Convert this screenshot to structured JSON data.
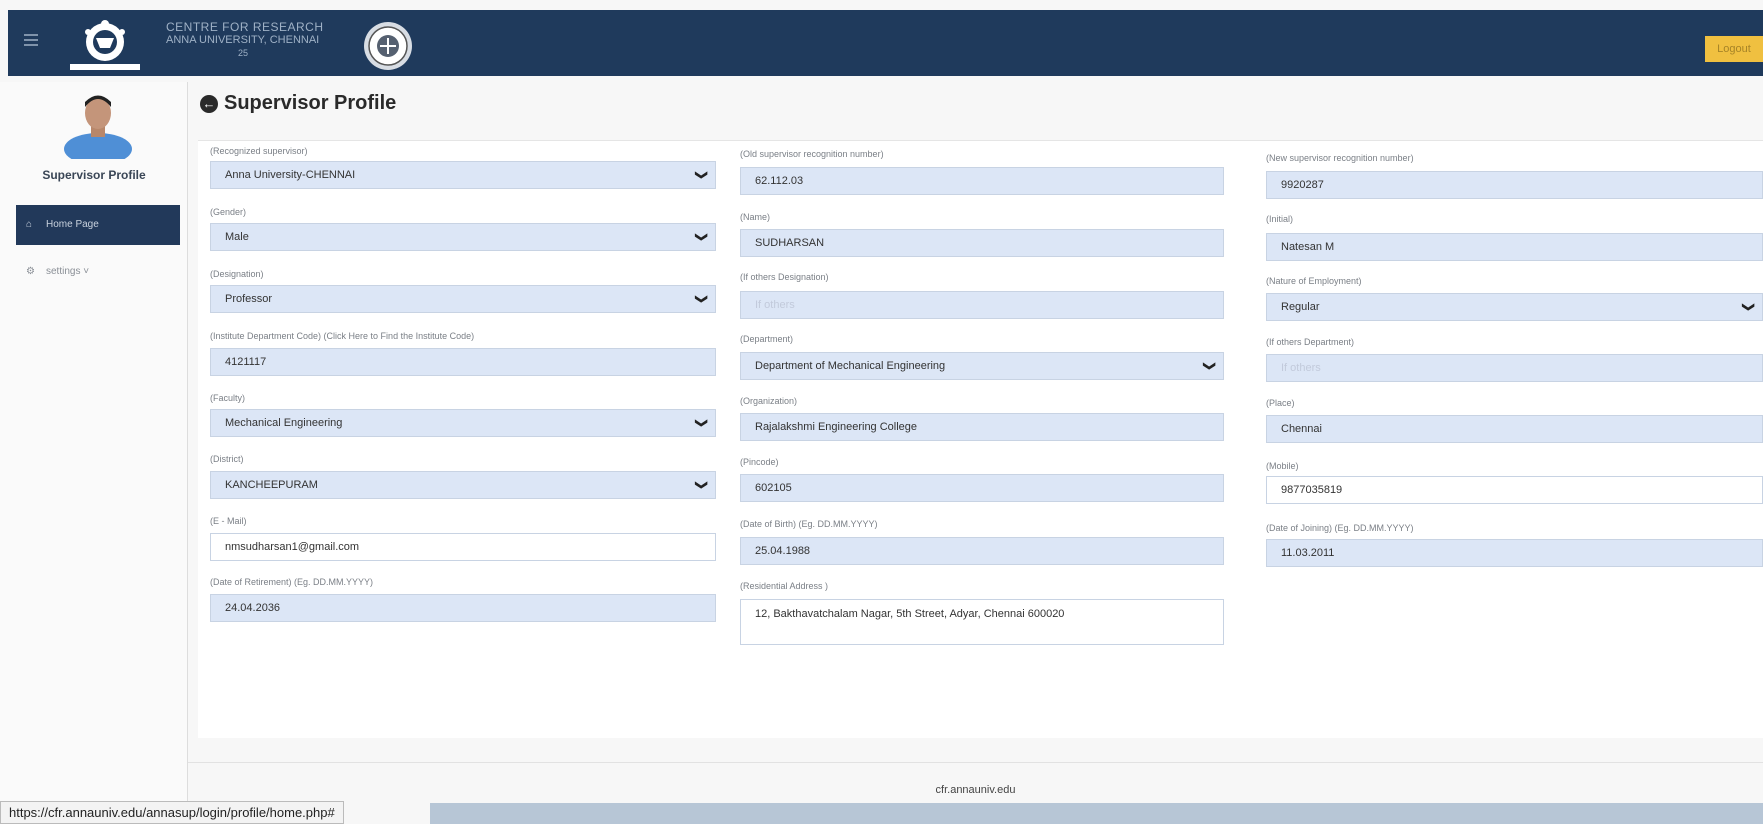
{
  "header": {
    "brand_line1": "CENTRE FOR RESEARCH",
    "brand_line2": "ANNA UNIVERSITY, CHENNAI",
    "brand_line3": "25",
    "logout_label": "Logout"
  },
  "sidebar": {
    "title": "Supervisor Profile",
    "items": [
      {
        "label": "Home Page",
        "icon": "home-icon"
      },
      {
        "label": "settings",
        "icon": "gear-icon"
      }
    ]
  },
  "page": {
    "title": "Supervisor Profile"
  },
  "form": {
    "recognized_supervisor": {
      "label": "(Recognized supervisor)",
      "value": "Anna University-CHENNAI"
    },
    "old_recognition_number": {
      "label": "(Old supervisor recognition number)",
      "value": "62.112.03"
    },
    "new_recognition_number": {
      "label": "(New supervisor recognition number)",
      "value": "9920287"
    },
    "gender": {
      "label": "(Gender)",
      "value": "Male"
    },
    "name": {
      "label": "(Name)",
      "value": "SUDHARSAN"
    },
    "initial": {
      "label": "(Initial)",
      "value": "Natesan M"
    },
    "designation": {
      "label": "(Designation)",
      "value": "Professor"
    },
    "other_designation": {
      "label": "(If others Designation)",
      "placeholder": "If others"
    },
    "nature_of_employment": {
      "label": "(Nature of Employment)",
      "value": "Regular"
    },
    "institute_code": {
      "label": "(Institute Department Code) (Click Here to Find the Institute Code)",
      "value": "4121117"
    },
    "department": {
      "label": "(Department)",
      "value": "Department of Mechanical Engineering"
    },
    "other_department": {
      "label": "(If others Department)",
      "placeholder": "If others"
    },
    "faculty": {
      "label": "(Faculty)",
      "value": "Mechanical Engineering"
    },
    "organization": {
      "label": "(Organization)",
      "value": "Rajalakshmi Engineering College"
    },
    "place": {
      "label": "(Place)",
      "value": "Chennai"
    },
    "district": {
      "label": "(District)",
      "value": "KANCHEEPURAM"
    },
    "pincode": {
      "label": "(Pincode)",
      "value": "602105"
    },
    "mobile": {
      "label": "(Mobile)",
      "value": "9877035819"
    },
    "email": {
      "label": "(E - Mail)",
      "value": "nmsudharsan1@gmail.com"
    },
    "dob": {
      "label": "(Date of Birth) (Eg. DD.MM.YYYY)",
      "value": "25.04.1988"
    },
    "doj": {
      "label": "(Date of Joining) (Eg. DD.MM.YYYY)",
      "value": "11.03.2011"
    },
    "retirement": {
      "label": "(Date of Retirement) (Eg. DD.MM.YYYY)",
      "value": "24.04.2036"
    },
    "address": {
      "label": "(Residential Address )",
      "value": "12, Bakthavatchalam Nagar, 5th Street, Adyar, Chennai 600020"
    }
  },
  "footer": {
    "site": "cfr.annauniv.edu",
    "status_url": "https://cfr.annauniv.edu/annasup/login/profile/home.php#"
  }
}
